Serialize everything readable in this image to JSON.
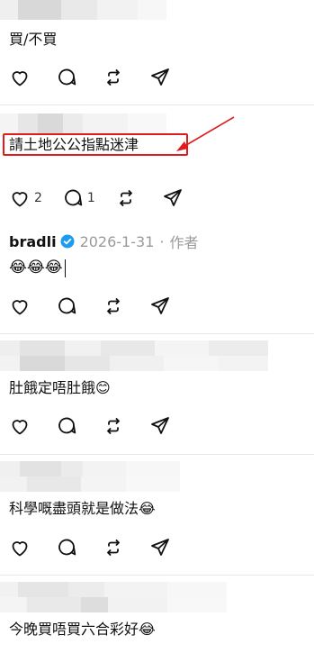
{
  "posts": [
    {
      "text": "買/不買"
    },
    {
      "text": "請土地公公指點迷津",
      "likes": "2",
      "replies": "1"
    },
    {
      "author": "bradli",
      "date": "2026-1-31",
      "sep": "·",
      "role": "作者",
      "text": "😂😂😂"
    },
    {
      "text": "肚餓定唔肚餓😊"
    },
    {
      "text": "科學嘅盡頭就是做法😂"
    },
    {
      "text": "今晚買唔買六合彩好😂"
    }
  ],
  "icons": [
    "heart-icon",
    "comment-icon",
    "repost-icon",
    "share-icon",
    "verified-icon",
    "arrow-icon"
  ],
  "colors": {
    "highlight": "#e01b1b",
    "verified": "#1d9bf0",
    "meta": "#9a9a9a"
  }
}
